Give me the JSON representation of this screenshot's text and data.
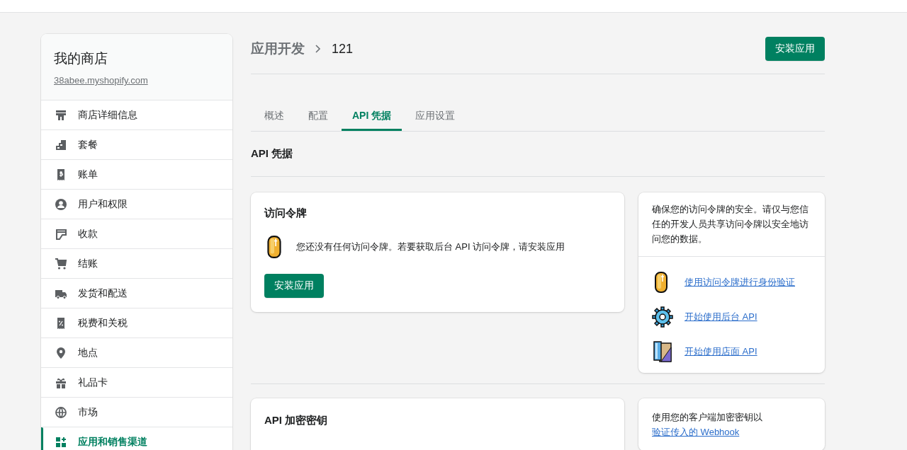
{
  "store": {
    "name": "我的商店",
    "domain": "38abee.myshopify.com"
  },
  "nav": [
    {
      "label": "商店详细信息",
      "selected": false
    },
    {
      "label": "套餐",
      "selected": false
    },
    {
      "label": "账单",
      "selected": false
    },
    {
      "label": "用户和权限",
      "selected": false
    },
    {
      "label": "收款",
      "selected": false
    },
    {
      "label": "结账",
      "selected": false
    },
    {
      "label": "发货和配送",
      "selected": false
    },
    {
      "label": "税费和关税",
      "selected": false
    },
    {
      "label": "地点",
      "selected": false
    },
    {
      "label": "礼品卡",
      "selected": false
    },
    {
      "label": "市场",
      "selected": false
    },
    {
      "label": "应用和销售渠道",
      "selected": true
    }
  ],
  "header": {
    "parent": "应用开发",
    "title": "121",
    "action": "安装应用"
  },
  "tabs": [
    {
      "label": "概述",
      "selected": false
    },
    {
      "label": "配置",
      "selected": false
    },
    {
      "label": "API 凭据",
      "selected": true
    },
    {
      "label": "应用设置",
      "selected": false
    }
  ],
  "section_title": "API 凭据",
  "access_token_card": {
    "title": "访问令牌",
    "message": "您还没有任何访问令牌。若要获取后台 API 访问令牌，请安装应用",
    "button": "安装应用"
  },
  "security_card": {
    "text": "确保您的访问令牌的安全。请仅与您信任的开发人员共享访问令牌以安全地访问您的数据。",
    "links": [
      {
        "label": "使用访问令牌进行身份验证"
      },
      {
        "label": "开始使用后台 API"
      },
      {
        "label": "开始使用店面 API"
      }
    ]
  },
  "secret_key_card": {
    "title": "API 加密密钥"
  },
  "webhook_card": {
    "text": "使用您的客户端加密密钥以",
    "link": "验证传入的 Webhook"
  }
}
